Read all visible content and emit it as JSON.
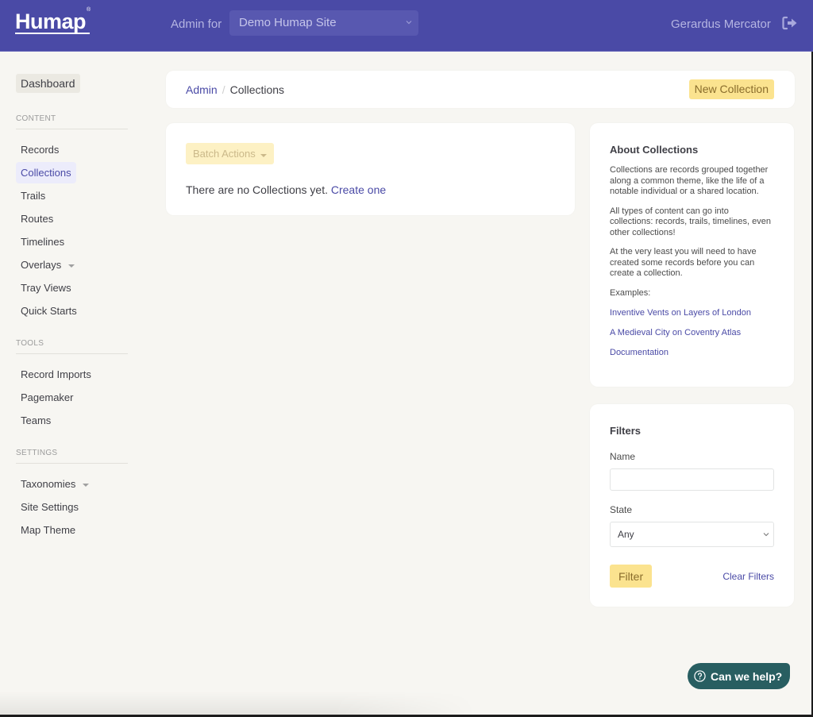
{
  "header": {
    "logo": "Humap",
    "logo_mark": "®",
    "admin_for_label": "Admin for",
    "site_select_value": "Demo Humap Site",
    "user_name": "Gerardus Mercator",
    "logout_icon": "sign-out-icon",
    "colors": {
      "bar": "#4a4aa6"
    }
  },
  "sidebar": {
    "dashboard": "Dashboard",
    "sections": [
      {
        "title": "CONTENT",
        "items": [
          {
            "label": "Records"
          },
          {
            "label": "Collections",
            "active": true
          },
          {
            "label": "Trails"
          },
          {
            "label": "Routes"
          },
          {
            "label": "Timelines"
          },
          {
            "label": "Overlays",
            "dropdown": true
          },
          {
            "label": "Tray Views"
          },
          {
            "label": "Quick Starts"
          }
        ]
      },
      {
        "title": "TOOLS",
        "items": [
          {
            "label": "Record Imports"
          },
          {
            "label": "Pagemaker"
          },
          {
            "label": "Teams"
          }
        ]
      },
      {
        "title": "SETTINGS",
        "items": [
          {
            "label": "Taxonomies",
            "dropdown": true
          },
          {
            "label": "Site Settings"
          },
          {
            "label": "Map Theme"
          }
        ]
      }
    ]
  },
  "breadcrumb": {
    "root": "Admin",
    "separator": "/",
    "current": "Collections",
    "new_button": "New Collection"
  },
  "main": {
    "batch_actions": "Batch Actions",
    "empty_text": "There are no Collections yet.",
    "create_link": "Create one"
  },
  "about": {
    "title": "About Collections",
    "paragraphs": [
      "Collections are records grouped together along a common theme, like the life of a notable individual or a shared location.",
      "All types of content can go into collections: records, trails, timelines, even other collections!",
      "At the very least you will need to have created some records before you can create a collection.",
      "Examples:"
    ],
    "links": [
      "Inventive Vents on Layers of London",
      "A Medieval City on Coventry Atlas",
      "Documentation"
    ]
  },
  "filters": {
    "title": "Filters",
    "name_label": "Name",
    "name_value": "",
    "state_label": "State",
    "state_value": "Any",
    "filter_button": "Filter",
    "clear_link": "Clear Filters"
  },
  "help": {
    "label": "Can we help?",
    "color": "#285e61"
  }
}
